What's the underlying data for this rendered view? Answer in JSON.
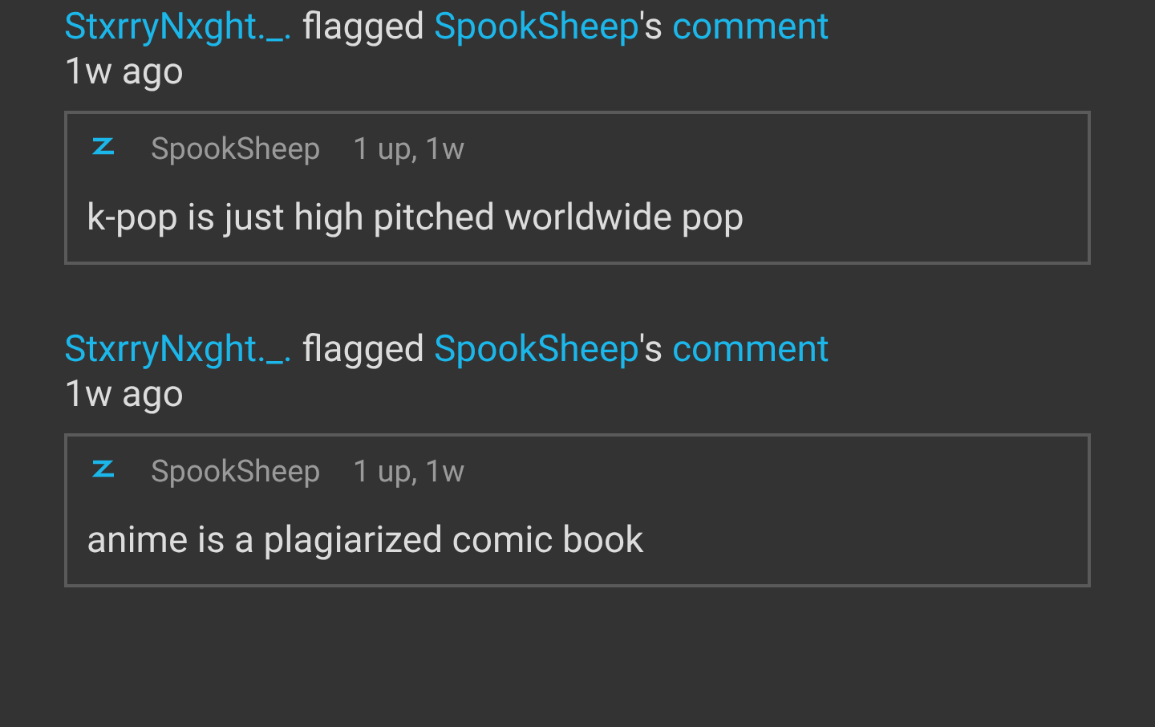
{
  "items": [
    {
      "actor": "StxrryNxght._.",
      "action": "flagged",
      "target": "SpookSheep",
      "possessive": "'s",
      "object": "comment",
      "time": "1w ago",
      "comment": {
        "author": "SpookSheep",
        "meta": "1 up, 1w",
        "text": "k-pop is just high pitched worldwide pop"
      }
    },
    {
      "actor": "StxrryNxght._.",
      "action": "flagged",
      "target": "SpookSheep",
      "possessive": "'s",
      "object": "comment",
      "time": "1w ago",
      "comment": {
        "author": "SpookSheep",
        "meta": "1 up, 1w",
        "text": "anime is a plagiarized comic book"
      }
    }
  ]
}
